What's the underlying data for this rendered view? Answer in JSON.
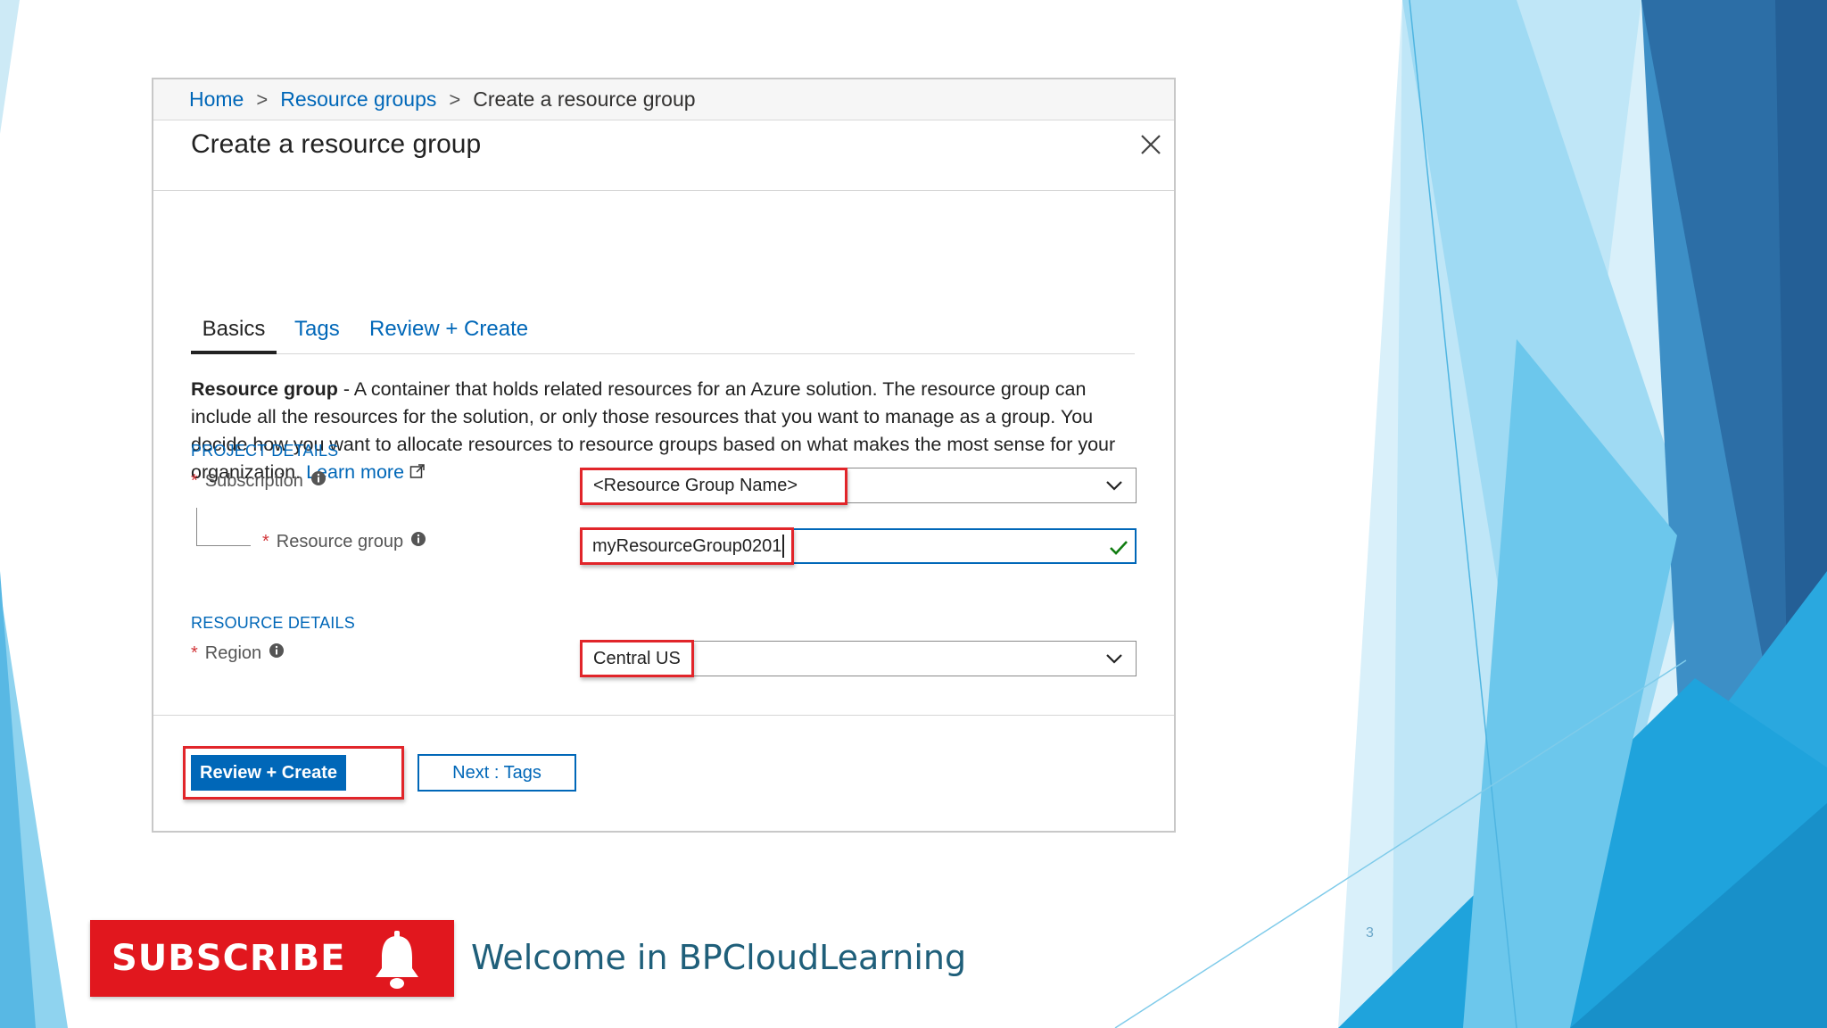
{
  "breadcrumb": {
    "home": "Home",
    "separator": ">",
    "resource_groups": "Resource groups",
    "current": "Create a resource group"
  },
  "panel": {
    "title": "Create a resource group"
  },
  "tabs": {
    "basics": "Basics",
    "tags": "Tags",
    "review": "Review + Create"
  },
  "description": {
    "bold_term": "Resource group",
    "text": " - A container that holds related resources for an Azure solution. The resource group can include all the resources for the solution, or only those resources that you want to manage as a group. You decide how you want to allocate resources to resource groups based on what makes the most sense for your organization. ",
    "learn_more": "Learn more"
  },
  "project_details": {
    "heading": "PROJECT DETAILS",
    "subscription_label": "Subscription",
    "subscription_value": "<Resource Group Name>",
    "resource_group_label": "Resource group",
    "resource_group_value": "myResourceGroup0201"
  },
  "resource_details": {
    "heading": "RESOURCE DETAILS",
    "region_label": "Region",
    "region_value": "Central US"
  },
  "required_marker": "*",
  "footer": {
    "review_create_button": "Review + Create",
    "next_button": "Next : Tags"
  },
  "banner": {
    "subscribe": "SUBSCRIBE",
    "welcome": "Welcome in BPCloudLearning"
  },
  "slide_number": "3",
  "colors": {
    "azure_blue": "#0067b8",
    "highlight_red": "#e1252a",
    "subscribe_red": "#e1171e",
    "required_red": "#d13438",
    "valid_green": "#107c10"
  },
  "icons": {
    "close": "close-icon",
    "chevron": "chevron-down-icon",
    "info": "info-icon",
    "check": "checkmark-icon",
    "external": "external-link-icon",
    "bell": "bell-icon"
  }
}
